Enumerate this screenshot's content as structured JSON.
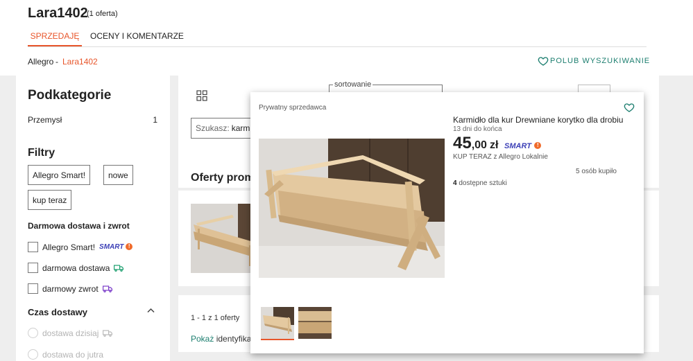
{
  "header": {
    "seller_name": "Lara1402",
    "offer_count": "(1 oferta)",
    "tabs": [
      {
        "label": "SPRZEDAJĘ",
        "active": true
      },
      {
        "label": "OCENY I KOMENTARZE",
        "active": false
      }
    ],
    "breadcrumb": {
      "root": "Allegro",
      "separator": "-",
      "current": "Lara1402"
    },
    "like_search_label": "POLUB WYSZUKIWANIE"
  },
  "sidebar": {
    "subcategories_title": "Podkategorie",
    "subcategories": [
      {
        "label": "Przemysł",
        "count": "1"
      }
    ],
    "filters_title": "Filtry",
    "filter_chips": [
      "Allegro Smart!",
      "nowe",
      "kup teraz"
    ],
    "delivery_title": "Darmowa dostawa i zwrot",
    "delivery_options": [
      {
        "label": "Allegro Smart!",
        "icon": "smart-logo",
        "checked": false
      },
      {
        "label": "darmowa dostawa",
        "icon": "truck-icon",
        "checked": false
      },
      {
        "label": "darmowy zwrot",
        "icon": "return-truck-icon",
        "checked": false
      }
    ],
    "smart_logo_text": "SMART",
    "smart_badge_text": "!",
    "delivery_time_title": "Czas dostawy",
    "delivery_time_options": [
      {
        "label": "dostawa dzisiaj",
        "enabled": false
      },
      {
        "label": "dostawa do jutra",
        "enabled": false
      }
    ]
  },
  "listing": {
    "search_label": "Szukasz:",
    "search_value": "karmidło",
    "sort_label": "sortowanie",
    "promoted_title": "Oferty promo",
    "pagination": "1 - 1 z 1 oferty",
    "show_ids_link": "Pokaż",
    "show_ids_rest": "identyfikato"
  },
  "popover": {
    "seller_type": "Prywatny sprzedawca",
    "title": "Karmidło dla kur Drewniane korytko dla drobiu",
    "time_left": "13 dni do końca",
    "price_int": "45",
    "price_frac": ",00",
    "currency": "zł",
    "smart_text": "SMART",
    "buy_type": "KUP TERAZ z Allegro Lokalnie",
    "bought": "5 osób kupiło",
    "stock_count": "4",
    "stock_label": "dostępne sztuki"
  },
  "colors": {
    "accent": "#e8552a",
    "teal": "#1c7e6f",
    "smart_purple": "#3b3fb6",
    "smart_orange": "#f06b2b"
  }
}
